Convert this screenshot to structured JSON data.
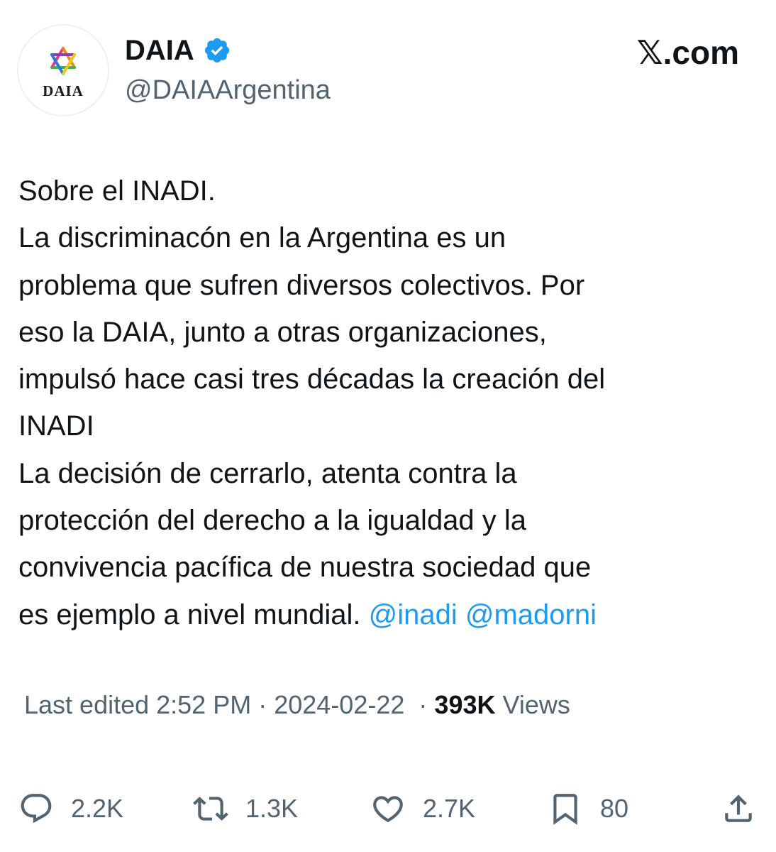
{
  "author": {
    "display_name": "DAIA",
    "handle": "@DAIAArgentina",
    "avatar_text": "DAIA",
    "verified": true
  },
  "brand": "𝕏.com",
  "tweet": {
    "lines": [
      "Sobre el INADI.",
      "La discriminacón en la Argentina es un",
      "problema que sufren diversos colectivos. Por",
      "eso la DAIA, junto a otras organizaciones,",
      "impulsó hace casi tres décadas la creación del",
      "INADI",
      "La decisión de cerrarlo, atenta contra la",
      "protección del derecho a la igualdad y la",
      "convivencia pacífica de nuestra sociedad que"
    ],
    "last_line_text": "es ejemplo a nivel mundial.",
    "mentions": [
      "@inadi",
      "@madorni"
    ]
  },
  "meta": {
    "edited_time": "Last edited 2:52 PM",
    "separator": "·",
    "date": "2024-02-22",
    "views_count": "393K",
    "views_label": "Views"
  },
  "actions": {
    "replies": "2.2K",
    "reposts": "1.3K",
    "likes": "2.7K",
    "bookmarks": "80"
  },
  "icons": {
    "reply": "speech-bubble-icon",
    "repost": "repost-arrows-icon",
    "like": "heart-icon",
    "bookmark": "bookmark-icon",
    "share": "share-upload-icon",
    "verified": "verified-badge-icon",
    "logo": "multicolor-star-of-david-icon"
  },
  "colors": {
    "text": "#0f1419",
    "secondary": "#536471",
    "accent": "#1d9bf0"
  }
}
